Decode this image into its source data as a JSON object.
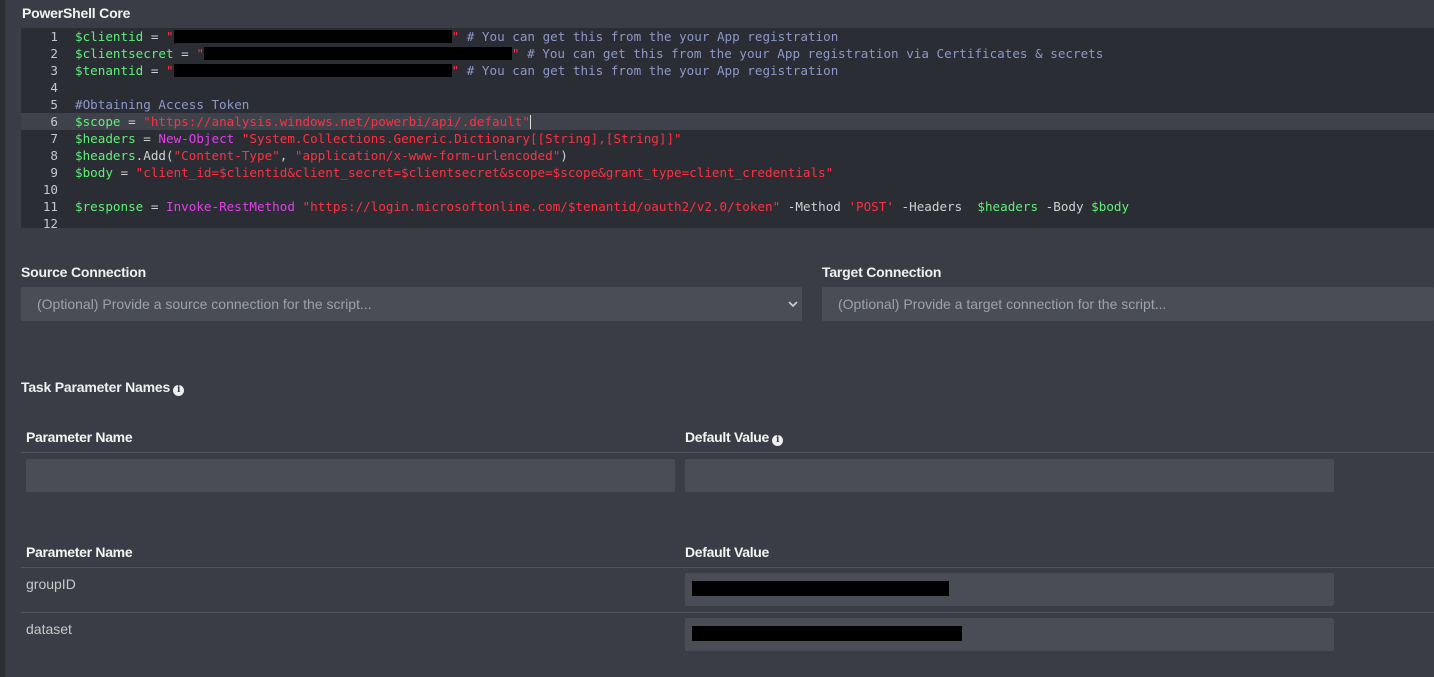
{
  "editor": {
    "title": "PowerShell Core",
    "lines": [
      {
        "n": "1",
        "tokens": [
          {
            "c": "var",
            "t": "$clientid"
          },
          {
            "c": "op",
            "t": " = "
          },
          {
            "c": "str",
            "t": "\""
          },
          {
            "c": "redact",
            "w": 278
          },
          {
            "c": "str",
            "t": "\""
          },
          {
            "c": "com",
            "t": " # You can get this from the your App registration"
          }
        ]
      },
      {
        "n": "2",
        "tokens": [
          {
            "c": "var",
            "t": "$clientsecret"
          },
          {
            "c": "op",
            "t": " = "
          },
          {
            "c": "str",
            "t": "\""
          },
          {
            "c": "redact",
            "w": 308
          },
          {
            "c": "str",
            "t": "\""
          },
          {
            "c": "com",
            "t": " # You can get this from the your App registration via Certificates & secrets"
          }
        ]
      },
      {
        "n": "3",
        "tokens": [
          {
            "c": "var",
            "t": "$tenantid"
          },
          {
            "c": "op",
            "t": " = "
          },
          {
            "c": "str",
            "t": "\""
          },
          {
            "c": "redact",
            "w": 278
          },
          {
            "c": "str",
            "t": "\""
          },
          {
            "c": "com",
            "t": " # You can get this from the your App registration"
          }
        ]
      },
      {
        "n": "4",
        "tokens": []
      },
      {
        "n": "5",
        "tokens": [
          {
            "c": "com",
            "t": "#Obtaining Access Token"
          }
        ]
      },
      {
        "n": "6",
        "active": true,
        "tokens": [
          {
            "c": "var",
            "t": "$scope"
          },
          {
            "c": "op",
            "t": " = "
          },
          {
            "c": "str",
            "t": "\"https://analysis.windows.net/powerbi/api/.default\""
          },
          {
            "c": "cursor"
          }
        ]
      },
      {
        "n": "7",
        "tokens": [
          {
            "c": "var",
            "t": "$headers"
          },
          {
            "c": "op",
            "t": " = "
          },
          {
            "c": "cmd",
            "t": "New-Object"
          },
          {
            "c": "op",
            "t": " "
          },
          {
            "c": "str",
            "t": "\"System.Collections.Generic.Dictionary[[String],[String]]\""
          }
        ]
      },
      {
        "n": "8",
        "tokens": [
          {
            "c": "var",
            "t": "$headers"
          },
          {
            "c": "op",
            "t": ".Add("
          },
          {
            "c": "str",
            "t": "\"Content-Type\""
          },
          {
            "c": "op",
            "t": ", "
          },
          {
            "c": "str",
            "t": "\"application/x-www-form-urlencoded\""
          },
          {
            "c": "op",
            "t": ")"
          }
        ]
      },
      {
        "n": "9",
        "tokens": [
          {
            "c": "var",
            "t": "$body"
          },
          {
            "c": "op",
            "t": " = "
          },
          {
            "c": "str",
            "t": "\"client_id=$clientid&client_secret=$clientsecret&scope=$scope&grant_type=client_credentials\""
          }
        ]
      },
      {
        "n": "10",
        "tokens": []
      },
      {
        "n": "11",
        "tokens": [
          {
            "c": "var",
            "t": "$response"
          },
          {
            "c": "op",
            "t": " = "
          },
          {
            "c": "cmd",
            "t": "Invoke-RestMethod"
          },
          {
            "c": "op",
            "t": " "
          },
          {
            "c": "str",
            "t": "\"https://login.microsoftonline.com/$tenantid/oauth2/v2.0/token\""
          },
          {
            "c": "op",
            "t": " "
          },
          {
            "c": "par",
            "t": "-"
          },
          {
            "c": "op",
            "t": "Method "
          },
          {
            "c": "str",
            "t": "'POST'"
          },
          {
            "c": "op",
            "t": " "
          },
          {
            "c": "par",
            "t": "-"
          },
          {
            "c": "op",
            "t": "Headers  "
          },
          {
            "c": "var",
            "t": "$headers"
          },
          {
            "c": "op",
            "t": " "
          },
          {
            "c": "par",
            "t": "-"
          },
          {
            "c": "op",
            "t": "Body "
          },
          {
            "c": "var",
            "t": "$body"
          }
        ]
      },
      {
        "n": "12",
        "tokens": []
      }
    ]
  },
  "source": {
    "label": "Source Connection",
    "placeholder": "(Optional) Provide a source connection for the script..."
  },
  "target": {
    "label": "Target Connection",
    "placeholder": "(Optional) Provide a target connection for the script..."
  },
  "params": {
    "title": "Task Parameter Names",
    "info_icon": "i",
    "new_header_name": "Parameter Name",
    "new_header_value": "Default Value",
    "list_header_name": "Parameter Name",
    "list_header_value": "Default Value",
    "rows": [
      {
        "name": "groupID"
      },
      {
        "name": "dataset"
      }
    ]
  },
  "colors": {
    "background": "#3a3d45",
    "editor_bg": "#2b2d34",
    "variable": "#5ff078",
    "string": "#ff3040",
    "comment": "#8e97c8",
    "command": "#e040e8"
  }
}
